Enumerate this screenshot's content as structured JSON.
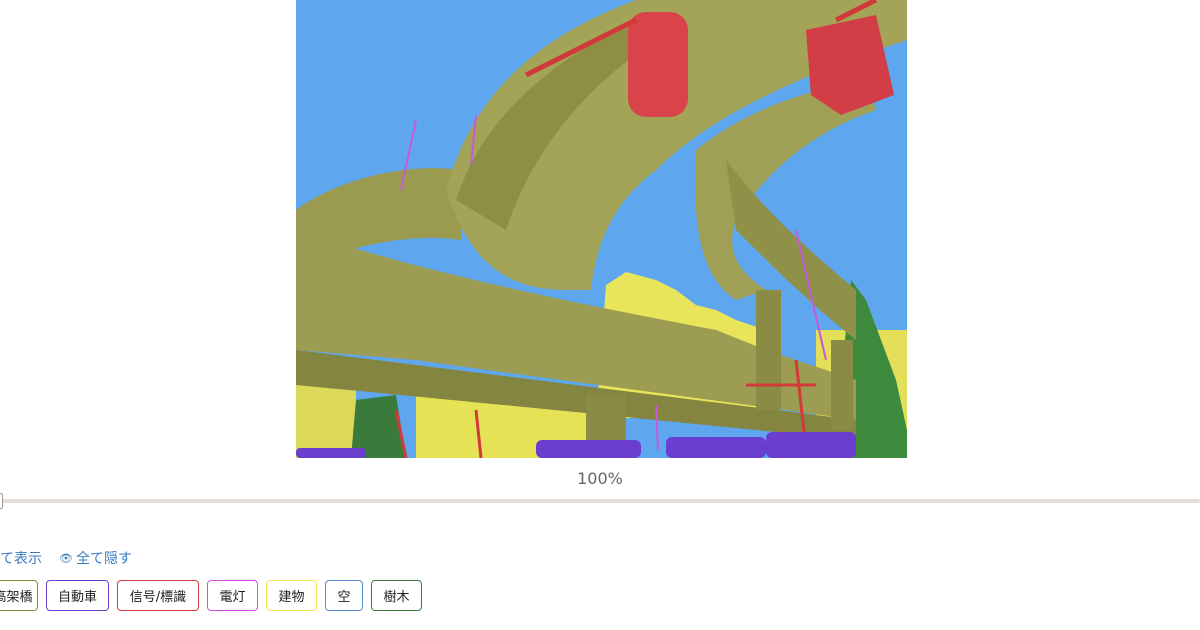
{
  "viewer": {
    "zoom_label": "100%",
    "zoom_percent": 100
  },
  "links": {
    "show_all": "全て表示",
    "hide_all": "全て隠す"
  },
  "legend": [
    {
      "label": "高架橋",
      "color": "#7f8b3a"
    },
    {
      "label": "自動車",
      "color": "#6a3fcf"
    },
    {
      "label": "信号/標識",
      "color": "#d23a3a"
    },
    {
      "label": "電灯",
      "color": "#d04fe0"
    },
    {
      "label": "建物",
      "color": "#efea5a"
    },
    {
      "label": "空",
      "color": "#5b8fd6"
    },
    {
      "label": "樹木",
      "color": "#3a7a3a"
    }
  ]
}
